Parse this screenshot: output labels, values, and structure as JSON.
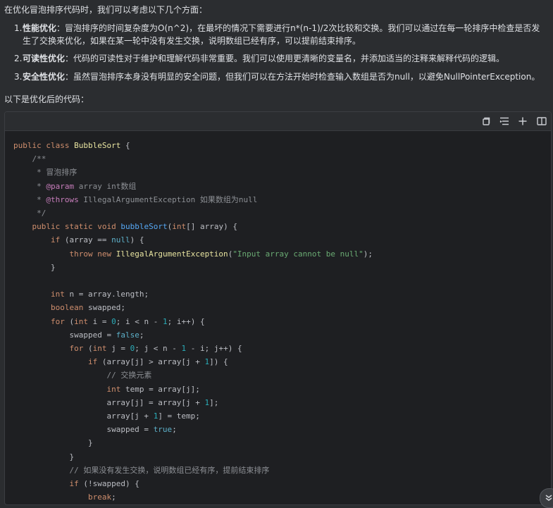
{
  "intro": "在优化冒泡排序代码时，我们可以考虑以下几个方面：",
  "points": [
    {
      "num": "1.",
      "title": "性能优化",
      "body": "：冒泡排序的时间复杂度为O(n^2)，在最坏的情况下需要进行n*(n-1)/2次比较和交换。我们可以通过在每一轮排序中检查是否发生了交换来优化，如果在某一轮中没有发生交换，说明数组已经有序，可以提前结束排序。"
    },
    {
      "num": "2.",
      "title": "可读性优化",
      "body": "：代码的可读性对于维护和理解代码非常重要。我们可以使用更清晰的变量名，并添加适当的注释来解释代码的逻辑。"
    },
    {
      "num": "3.",
      "title": "安全性优化",
      "body": "：虽然冒泡排序本身没有明显的安全问题，但我们可以在方法开始时检查输入数组是否为null，以避免NullPointerException。"
    }
  ],
  "after_text": "以下是优化后的代码：",
  "toolbar": {
    "icons": [
      "copy-icon",
      "format-icon",
      "plus-icon",
      "split-view-icon"
    ]
  },
  "code": {
    "language": "java",
    "lines": [
      "public class BubbleSort {",
      "    /**",
      "     * 冒泡排序",
      "     * @param array int数组",
      "     * @throws IllegalArgumentException 如果数组为null",
      "     */",
      "    public static void bubbleSort(int[] array) {",
      "        if (array == null) {",
      "            throw new IllegalArgumentException(\"Input array cannot be null\");",
      "        }",
      "",
      "        int n = array.length;",
      "        boolean swapped;",
      "        for (int i = 0; i < n - 1; i++) {",
      "            swapped = false;",
      "            for (int j = 0; j < n - 1 - i; j++) {",
      "                if (array[j] > array[j + 1]) {",
      "                    // 交换元素",
      "                    int temp = array[j];",
      "                    array[j] = array[j + 1];",
      "                    array[j + 1] = temp;",
      "                    swapped = true;",
      "                }",
      "            }",
      "            // 如果没有发生交换，说明数组已经有序，提前结束排序",
      "            if (!swapped) {",
      "                break;"
    ]
  },
  "scroll_button": {
    "icon": "chevron-down-icon"
  }
}
